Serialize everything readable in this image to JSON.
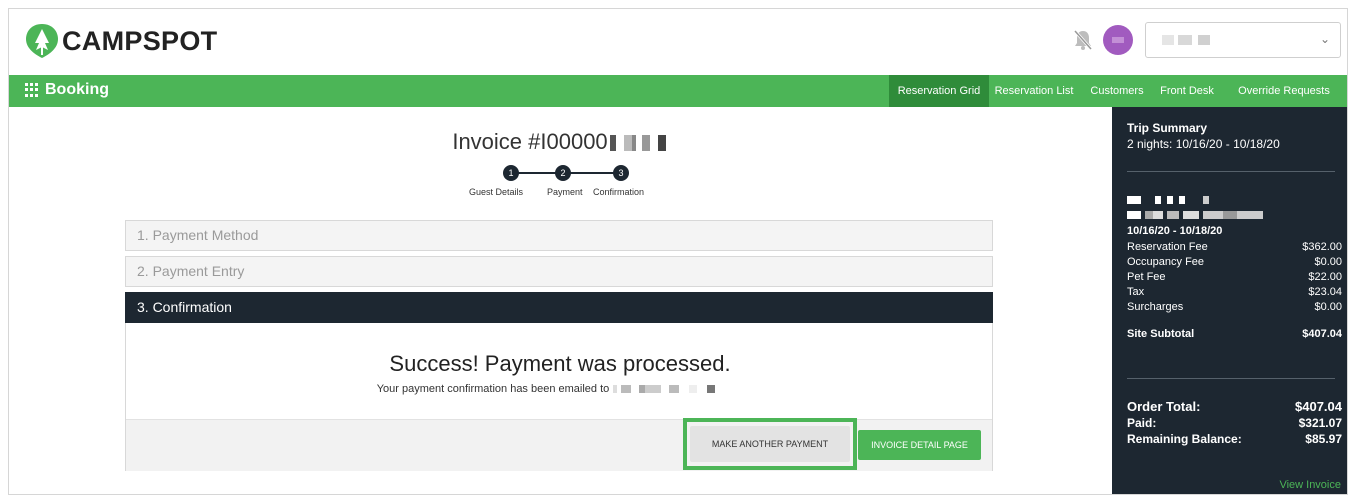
{
  "header": {
    "brand": "CAMPSPOT",
    "icons": {
      "logo": "tree-leaf-logo",
      "notifications": "bell-muted-icon",
      "dropdown": "chevron-down-icon"
    }
  },
  "navbar": {
    "title": "Booking",
    "links": [
      "Reservation Grid",
      "Reservation List",
      "Customers",
      "Front Desk",
      "Override Requests"
    ],
    "active": "Reservation Grid"
  },
  "main": {
    "invoice_title": "Invoice #I00000",
    "steps": [
      {
        "number": "1",
        "label": "Guest Details"
      },
      {
        "number": "2",
        "label": "Payment"
      },
      {
        "number": "3",
        "label": "Confirmation"
      }
    ],
    "sections": [
      "1. Payment Method",
      "2. Payment Entry",
      "3. Confirmation"
    ],
    "success_title": "Success! Payment was processed.",
    "email_line": "Your payment confirmation has been emailed to",
    "buttons": {
      "make_another": "MAKE ANOTHER PAYMENT",
      "invoice_detail": "INVOICE DETAIL PAGE"
    }
  },
  "summary": {
    "title": "Trip Summary",
    "nights": "2 nights: 10/16/20 - 10/18/20",
    "site_dates": "10/16/20 - 10/18/20",
    "fees": [
      {
        "label": "Reservation Fee",
        "value": "$362.00"
      },
      {
        "label": "Occupancy Fee",
        "value": "$0.00"
      },
      {
        "label": "Pet Fee",
        "value": "$22.00"
      },
      {
        "label": "Tax",
        "value": "$23.04"
      },
      {
        "label": "Surcharges",
        "value": "$0.00"
      }
    ],
    "subtotal": {
      "label": "Site Subtotal",
      "value": "$407.04"
    },
    "order_total": {
      "label": "Order Total:",
      "value": "$407.04"
    },
    "paid": {
      "label": "Paid:",
      "value": "$321.07"
    },
    "remaining": {
      "label": "Remaining Balance:",
      "value": "$85.97"
    },
    "view_invoice": "View Invoice"
  },
  "colors": {
    "brand_green": "#4cb557",
    "active_nav": "#2f8c3a",
    "dark_navy": "#1d2731",
    "avatar": "#a15bbf"
  }
}
